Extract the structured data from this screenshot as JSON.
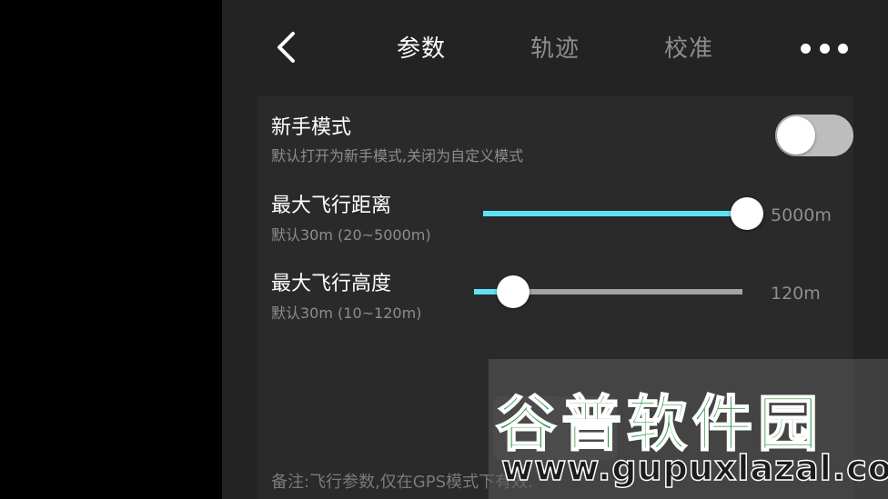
{
  "header": {
    "tabs": [
      {
        "label": "参数",
        "active": true
      },
      {
        "label": "轨迹",
        "active": false
      },
      {
        "label": "校准",
        "active": false
      }
    ],
    "back_icon": "chevron-left-icon",
    "more_icon": "more-dots-icon"
  },
  "settings": {
    "beginner_mode": {
      "title": "新手模式",
      "description": "默认打开为新手模式,关闭为自定义模式",
      "enabled": false
    },
    "max_distance": {
      "title": "最大飞行距离",
      "description": "默认30m (20~5000m)",
      "value_label": "5000m",
      "value": 5000,
      "min": 20,
      "max": 5000
    },
    "max_altitude": {
      "title": "最大飞行高度",
      "description": "默认30m (10~120m)",
      "value_label": "120m",
      "value": 26,
      "min": 10,
      "max": 120
    },
    "note": "备注:飞行参数,仅在GPS模式下有效."
  },
  "colors": {
    "accent": "#5de3f5",
    "track": "#a4a4a4",
    "panel": "#232323",
    "card": "#2a2a2a"
  },
  "watermark": {
    "text_cn": "谷普软件园",
    "text_url": "www.gupuxlazal.com"
  }
}
